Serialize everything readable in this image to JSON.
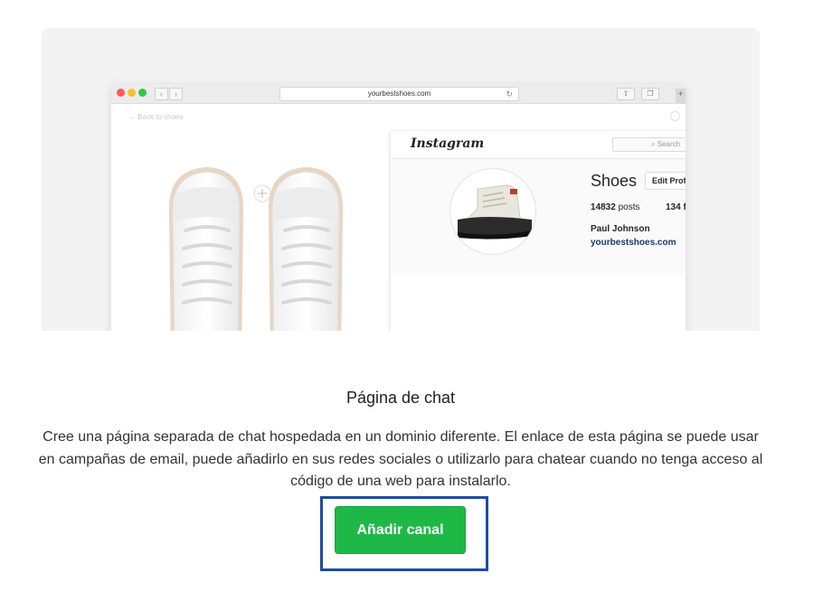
{
  "browser": {
    "url": "yourbestshoes.com",
    "back_link": "← Back to shoes"
  },
  "instagram": {
    "logo": "Instagram",
    "search_placeholder": "Search",
    "profile_name": "Shoes",
    "edit_button": "Edit Profi",
    "posts_count": "14832",
    "posts_label": "posts",
    "followers_partial": "134 f",
    "full_name": "Paul Johnson",
    "website": "yourbestshoes.com"
  },
  "content": {
    "title": "Página de chat",
    "description": "Cree una página separada de chat hospedada en un dominio diferente. El enlace de esta página se puede usar en campañas de email, puede añadirlo en sus redes sociales o utilizarlo para chatear cuando no tenga acceso al código de una web para instalarlo.",
    "add_button": "Añadir canal"
  },
  "colors": {
    "button_green": "#1fb847",
    "highlight_border": "#1e4ba3",
    "link_blue": "#1c3b66"
  }
}
